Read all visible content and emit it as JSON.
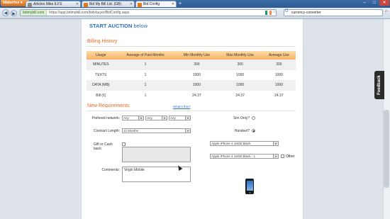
{
  "browser": {
    "app_button": "Waterfox",
    "tabs": [
      {
        "title": "Articles Mike ILFS",
        "fav_color": "#8a8a8a",
        "active": false
      },
      {
        "title": "Bid My Bill Ltd. (GB)",
        "fav_color": "#e07a20",
        "active": false
      },
      {
        "title": "Bid Config",
        "fav_color": "#e07a20",
        "active": true
      }
    ],
    "new_tab": "+",
    "window_controls": [
      "–",
      "□",
      "✕"
    ],
    "url_site": "bidmybill.com",
    "url_path": "https://app.bidmybill.com/bidvbuyer/BidConfig.aspx",
    "search_value": "currency-converter",
    "feedback_label": "Feedback"
  },
  "page": {
    "start_auction_prefix": "START AUCTION",
    "start_auction_suffix": "below",
    "billing_title": "Billing History",
    "billing_table": {
      "headers": [
        "Usage",
        "Average of Past Months",
        "Min Monthly Use",
        "Max Monthly Use",
        "Average Use"
      ],
      "rows": [
        [
          "MINUTES",
          "1",
          "300",
          "300",
          "300"
        ],
        [
          "TEXTS",
          "1",
          "1000",
          "1000",
          "1000"
        ],
        [
          "DATA (MB)",
          "1",
          "1000",
          "1000",
          "1000"
        ],
        [
          "Bill (€)",
          "1",
          "24.37",
          "24.37",
          "24.37"
        ]
      ]
    },
    "requirements_title": "New Requirements",
    "whats_this": "What's this?",
    "preferred_network_label": "Prefered network:",
    "network_selects": [
      "Any",
      "Any",
      "Any"
    ],
    "contract_length_label": "Contract Length:",
    "contract_length_value": "12 Months",
    "gift_label": "Gift or Cash back:",
    "comments_label": "Comments:",
    "comments_value": "Virgin Mobile",
    "sim_only_label": "Sim Only?",
    "handset_label": "Handset?",
    "handset_selected": true,
    "sim_only_selected": false,
    "handset_select_1": "Apple iPhone 4 16GB Black",
    "handset_select_2": "Apple iPhone 4 16GB Black - 1",
    "other_label": "Other",
    "accent_color": "#e46a2a",
    "link_color": "#2d6fb8"
  }
}
